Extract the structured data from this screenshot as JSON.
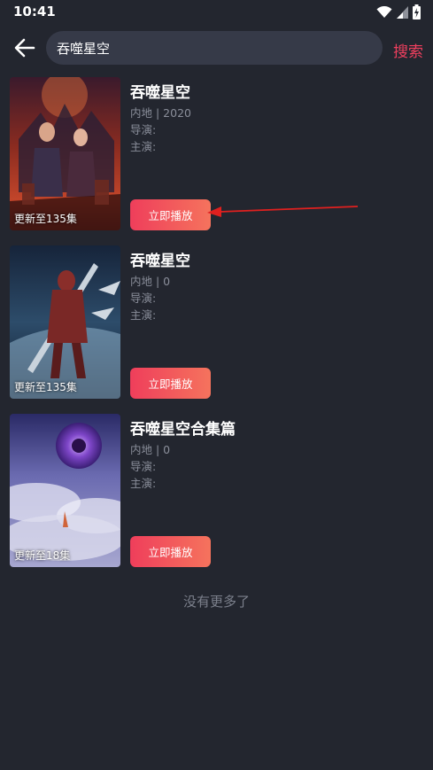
{
  "status_bar": {
    "time": "10:41"
  },
  "search": {
    "query": "吞噬星空",
    "button_label": "搜索"
  },
  "results": [
    {
      "title": "吞噬星空",
      "meta": "内地 | 2020",
      "director": "导演:",
      "cast": "主演:",
      "update": "更新至135集",
      "play_label": "立即播放"
    },
    {
      "title": "吞噬星空",
      "meta": "内地 | 0",
      "director": "导演:",
      "cast": "主演:",
      "update": "更新至135集",
      "play_label": "立即播放"
    },
    {
      "title": "吞噬星空合集篇",
      "meta": "内地 | 0",
      "director": "导演:",
      "cast": "主演:",
      "update": "更新至18集",
      "play_label": "立即播放"
    }
  ],
  "footer": {
    "no_more": "没有更多了"
  },
  "colors": {
    "background": "#23262f",
    "accent": "#ef3f5e",
    "search_box": "#363a48"
  },
  "icons": [
    "back-arrow-icon",
    "wifi-icon",
    "signal-icon",
    "battery-icon"
  ]
}
